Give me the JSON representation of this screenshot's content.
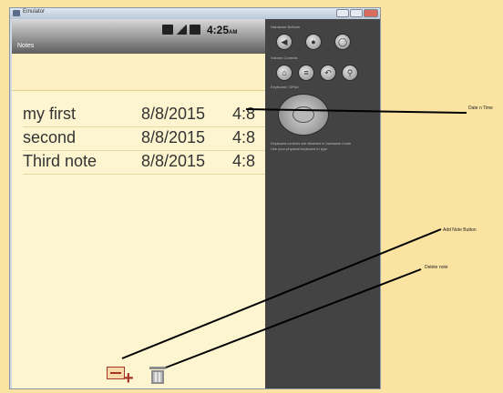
{
  "window": {
    "title": "Emulator"
  },
  "status_bar": {
    "time": "4:25",
    "ampm": "AM"
  },
  "app_bar": {
    "title": "Notes"
  },
  "notes": [
    {
      "name": "my first",
      "date": "8/8/2015",
      "time": "4:8"
    },
    {
      "name": "second",
      "date": "8/8/2015",
      "time": "4:8"
    },
    {
      "name": "Third note",
      "date": "8/8/2015",
      "time": "4:8"
    }
  ],
  "toolbar": {
    "add_icon": "add-note-icon",
    "delete_icon": "trash-icon"
  },
  "emulator_panel": {
    "section_1": "Hardware Buttons",
    "section_2": "Volume Controls",
    "section_3": "Keyboard / DPad",
    "section_4": "Keyboard controls are disabled in hardware mode",
    "section_4b": "Use your physical keyboard to type"
  },
  "annotations": {
    "date_time": "Date n Time",
    "add_button": "Add Note Button",
    "delete": "Delete note"
  },
  "colors": {
    "background": "#fbe3a2",
    "note_paper": "#fdf5cf",
    "panel": "#434343",
    "accent": "#a53524"
  }
}
